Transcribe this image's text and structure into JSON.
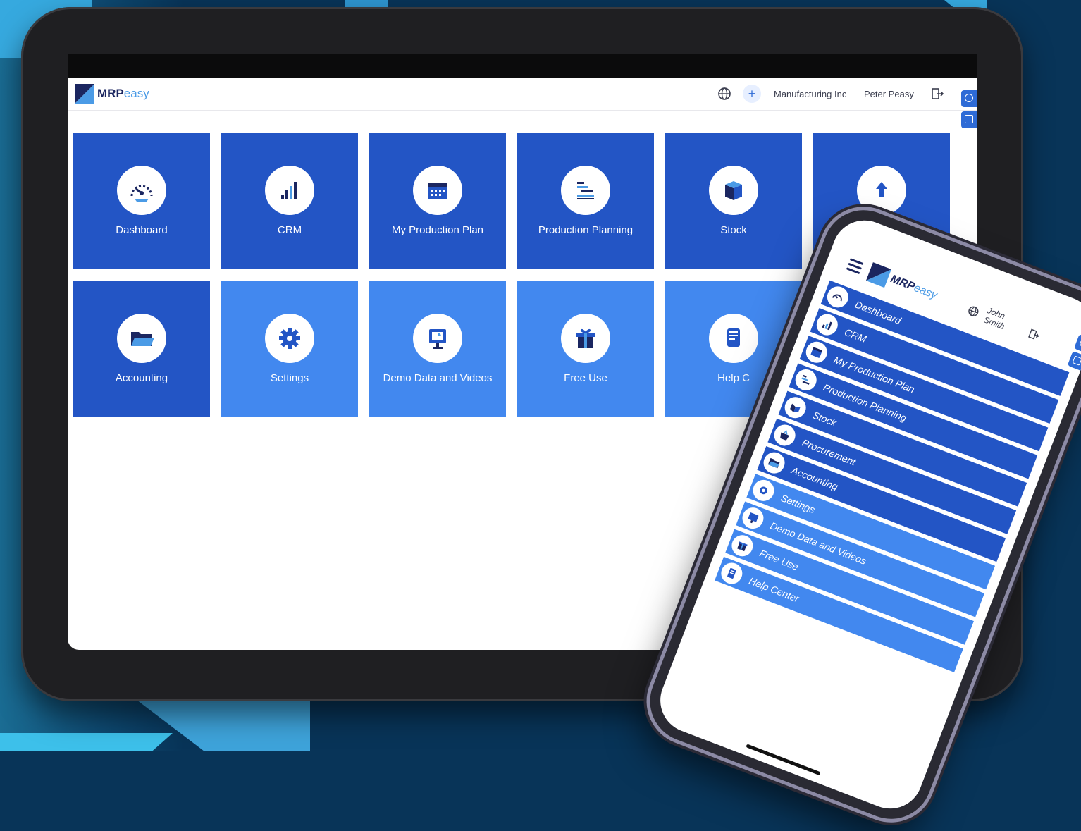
{
  "colors": {
    "background": "#083458",
    "tile_dark": "#2355c5",
    "tile_light": "#4288ef",
    "brand_navy": "#1b2660",
    "brand_light": "#4b9be6",
    "accent": "#2e6bd6"
  },
  "tablet": {
    "header": {
      "logo_bold": "MRP",
      "logo_light": "easy",
      "company": "Manufacturing Inc",
      "user": "Peter Peasy",
      "icons": [
        "globe-icon",
        "plus-icon",
        "logout-icon"
      ]
    },
    "tiles": [
      {
        "label": "Dashboard",
        "icon": "dashboard-gauge-icon",
        "style": "dark"
      },
      {
        "label": "CRM",
        "icon": "bar-chart-icon",
        "style": "dark"
      },
      {
        "label": "My Production Plan",
        "icon": "calendar-icon",
        "style": "dark"
      },
      {
        "label": "Production Planning",
        "icon": "planning-icon",
        "style": "dark"
      },
      {
        "label": "Stock",
        "icon": "box-icon",
        "style": "dark"
      },
      {
        "label": "",
        "icon": "upload-icon",
        "style": "dark"
      },
      {
        "label": "Accounting",
        "icon": "folder-icon",
        "style": "dark"
      },
      {
        "label": "Settings",
        "icon": "gear-icon",
        "style": "light"
      },
      {
        "label": "Demo Data and Videos",
        "icon": "presentation-icon",
        "style": "light"
      },
      {
        "label": "Free Use",
        "icon": "gift-icon",
        "style": "light"
      },
      {
        "label": "Help C",
        "icon": "document-icon",
        "style": "light"
      }
    ]
  },
  "phone": {
    "header": {
      "logo_bold": "MRP",
      "logo_light": "easy",
      "user": "John Smith"
    },
    "menu": [
      {
        "label": "Dashboard",
        "icon": "dashboard-gauge-icon",
        "style": "dark"
      },
      {
        "label": "CRM",
        "icon": "bar-chart-icon",
        "style": "dark"
      },
      {
        "label": "My Production Plan",
        "icon": "calendar-icon",
        "style": "dark"
      },
      {
        "label": "Production Planning",
        "icon": "planning-icon",
        "style": "dark"
      },
      {
        "label": "Stock",
        "icon": "box-icon",
        "style": "dark"
      },
      {
        "label": "Procurement",
        "icon": "basket-icon",
        "style": "dark"
      },
      {
        "label": "Accounting",
        "icon": "folder-icon",
        "style": "dark"
      },
      {
        "label": "Settings",
        "icon": "gear-icon",
        "style": "light"
      },
      {
        "label": "Demo Data and Videos",
        "icon": "presentation-icon",
        "style": "light"
      },
      {
        "label": "Free Use",
        "icon": "gift-icon",
        "style": "light"
      },
      {
        "label": "Help Center",
        "icon": "document-icon",
        "style": "light"
      }
    ]
  }
}
